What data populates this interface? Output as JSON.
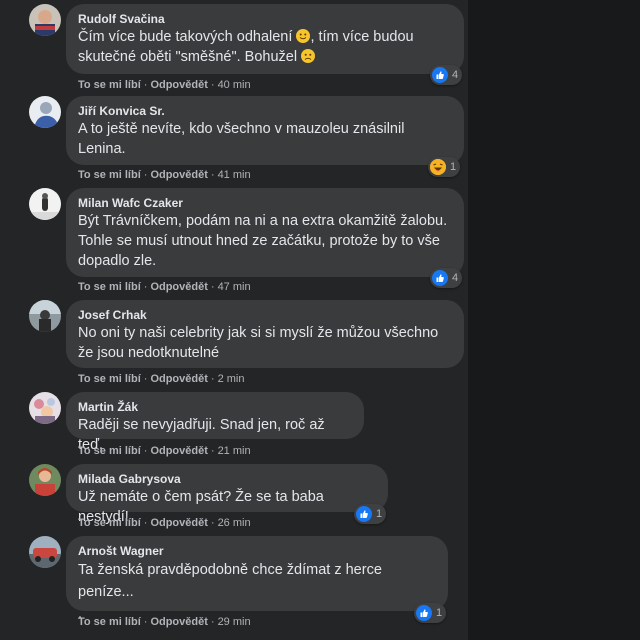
{
  "colors": {
    "like_blue": "#1877f2",
    "haha_yellow": "#f7b125",
    "bubble": "#3a3b3c"
  },
  "labels": {
    "like": "To se mi líbí",
    "reply": "Odpovědět"
  },
  "comments": [
    {
      "author": "Rudolf Svačina",
      "lines": [
        "Čím více bude takových odhalení",
        ", tím více budou",
        "skutečné oběti \"směšné\". Bohužel"
      ],
      "time": "40 min",
      "reaction": "like-icon",
      "reaction_count": "4"
    },
    {
      "author": "Jiří Konvica Sr.",
      "lines": [
        "A to ještě nevíte, kdo všechno v mauzoleu znásilnil",
        "Lenina."
      ],
      "time": "41 min",
      "reaction": "haha-icon",
      "reaction_count": "1"
    },
    {
      "author": "Milan Wafc Czaker",
      "lines": [
        "Být Trávníčkem, podám na ni a na extra okamžitě žalobu.",
        "Tohle se musí utnout hned ze začátku, protože by to vše",
        "dopadlo zle."
      ],
      "time": "47 min",
      "reaction": "like-icon",
      "reaction_count": "4"
    },
    {
      "author": "Josef Crhak",
      "lines": [
        "No oni ty naši celebrity jak si si myslí že můžou všechno",
        "že jsou nedotknutelné"
      ],
      "time": "2 min"
    },
    {
      "author": "Martin Žák",
      "lines": [
        "Raději se nevyjadřuji. Snad jen, roč až teď."
      ],
      "time": "21 min"
    },
    {
      "author": "Milada Gabrysova",
      "lines": [
        "Už nemáte o čem psát? Že se ta baba nestydí!"
      ],
      "time": "26 min",
      "reaction": "like-icon",
      "reaction_count": "1"
    },
    {
      "author": "Arnošt Wagner",
      "lines": [
        "Ta ženská pravděpodobně chce ždímat z herce peníze...",
        "."
      ],
      "time": "29 min",
      "reaction": "like-icon",
      "reaction_count": "1"
    }
  ]
}
